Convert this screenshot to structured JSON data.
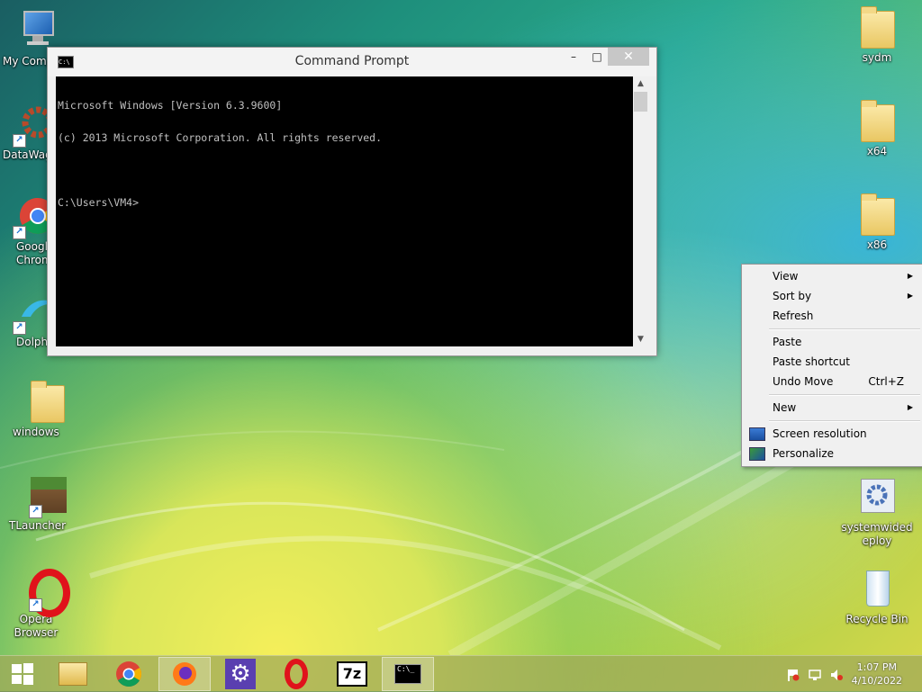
{
  "desktop_icons_left": [
    {
      "id": "my-computer",
      "label": "My Comp"
    },
    {
      "id": "datawag",
      "label": "DataWag"
    },
    {
      "id": "chrome",
      "label": "Googl\nChrom"
    },
    {
      "id": "dolphin",
      "label": "Dolphi"
    },
    {
      "id": "windows-folder",
      "label": "windows"
    },
    {
      "id": "tlauncher",
      "label": "TLauncher"
    },
    {
      "id": "opera",
      "label": "Opera\nBrowser"
    }
  ],
  "desktop_icons_right": [
    {
      "id": "sydm",
      "label": "sydm"
    },
    {
      "id": "x64",
      "label": "x64"
    },
    {
      "id": "x86",
      "label": "x86"
    },
    {
      "id": "systemwidedeploy",
      "label": "systemwided\neploy"
    },
    {
      "id": "recycle-bin",
      "label": "Recycle Bin"
    }
  ],
  "cmd": {
    "title": "Command Prompt",
    "app_icon_text": "C:\\",
    "lines": [
      "Microsoft Windows [Version 6.3.9600]",
      "(c) 2013 Microsoft Corporation. All rights reserved.",
      "",
      "C:\\Users\\VM4>"
    ],
    "minimize": "–",
    "maximize": "□",
    "close": "✕"
  },
  "context_menu": {
    "view": "View",
    "sort_by": "Sort by",
    "refresh": "Refresh",
    "paste": "Paste",
    "paste_shortcut": "Paste shortcut",
    "undo_move": "Undo Move",
    "undo_shortcut": "Ctrl+Z",
    "new": "New",
    "screen_resolution": "Screen resolution",
    "personalize": "Personalize"
  },
  "taskbar": {
    "seven_zip": "7z",
    "cmd_icon_text": "C:\\_",
    "time": "1:07 PM",
    "date": "4/10/2022"
  },
  "colors": {
    "accent": "#1a6fd1",
    "console_bg": "#000000",
    "console_fg": "#c0c0c0"
  }
}
